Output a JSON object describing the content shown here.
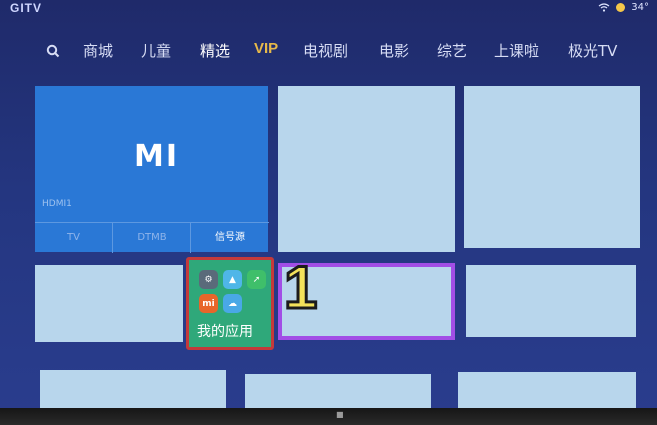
{
  "top_bar": {
    "brand": "GITV",
    "temperature": "34°"
  },
  "nav": {
    "items": [
      {
        "label": "商城"
      },
      {
        "label": "儿童"
      },
      {
        "label": "精选"
      },
      {
        "label": "VIP"
      },
      {
        "label": "电视剧"
      },
      {
        "label": "电影"
      },
      {
        "label": "综艺"
      },
      {
        "label": "上课啦"
      },
      {
        "label": "极光TV"
      }
    ],
    "active": "精选"
  },
  "mi_tile": {
    "logo": "MI",
    "input_label": "HDMI1",
    "sources": [
      "TV",
      "DTMB",
      "信号源"
    ],
    "selected_source": "信号源"
  },
  "apps_tile": {
    "label": "我的应用",
    "icons": [
      "settings-icon",
      "gallery-icon",
      "rocket-icon",
      "mi-app-icon",
      "cloud-icon"
    ]
  },
  "annotation": {
    "marker": "1"
  },
  "colors": {
    "mi_blue": "#2a78d6",
    "apps_green": "#2fa87a",
    "highlight_red": "#c43a3a",
    "focus_purple": "#a24ee6",
    "vip_gold": "#e6b94a",
    "marker_yellow": "#f3e25a"
  }
}
